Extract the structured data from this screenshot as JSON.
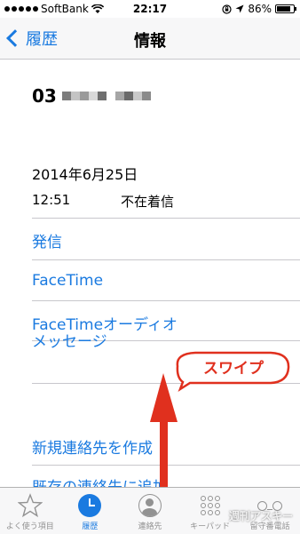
{
  "status_bar": {
    "carrier": "SoftBank",
    "time": "22:17",
    "battery_percent": "86%",
    "battery_level": 0.86
  },
  "nav": {
    "back_label": "履歴",
    "title": "情報"
  },
  "contact": {
    "phone_prefix": "03"
  },
  "call": {
    "date": "2014年6月25日",
    "time": "12:51",
    "status": "不在着信"
  },
  "actions": {
    "call": "発信",
    "facetime": "FaceTime",
    "facetime_audio": "FaceTimeオーディオ",
    "message": "メッセージ",
    "new_contact": "新規連絡先を作成",
    "add_existing": "既存の連絡先に追加"
  },
  "annotation": {
    "swipe": "スワイプ",
    "color": "#e0301e"
  },
  "tabs": [
    {
      "label": "よく使う項目",
      "icon": "star-icon"
    },
    {
      "label": "履歴",
      "icon": "clock-icon"
    },
    {
      "label": "連絡先",
      "icon": "contacts-icon"
    },
    {
      "label": "キーパッド",
      "icon": "keypad-icon"
    },
    {
      "label": "留守番電話",
      "icon": "voicemail-icon"
    }
  ],
  "watermark": "週刊アスキー",
  "colors": {
    "accent": "#1a7ae0",
    "separator": "#c8c7cc",
    "tab_inactive": "#929292"
  }
}
